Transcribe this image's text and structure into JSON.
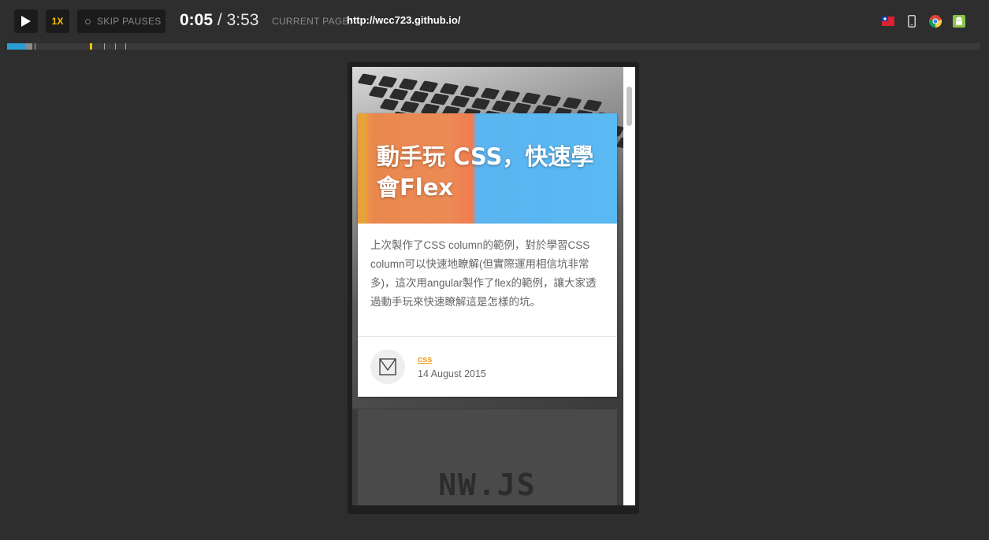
{
  "player": {
    "play_label": "play",
    "speed": "1X",
    "skip_pauses": "SKIP PAUSES",
    "time_current": "0:05",
    "time_separator": "/",
    "time_total": "3:53",
    "current_page_label": "CURRENT PAGE:",
    "current_page_url": "http://wcc723.github.io/",
    "progress": 0.021
  },
  "environment": {
    "icons": [
      "taiwan-flag-icon",
      "mobile-device-icon",
      "chrome-icon",
      "android-icon"
    ]
  },
  "colors": {
    "accent": "#2a9fd6",
    "highlight": "#f5c400",
    "tag": "#f0a01e"
  },
  "article": {
    "title": "動手玩 CSS，快速學會Flex",
    "excerpt": "上次製作了CSS column的範例，對於學習CSS column可以快速地瞭解(但實際運用相信坑非常多)，這次用angular製作了flex的範例，讓大家透過動手玩來快速瞭解這是怎樣的坑。",
    "tag": "css",
    "date": "14 August 2015"
  },
  "next_article": {
    "title": "NW.JS"
  }
}
